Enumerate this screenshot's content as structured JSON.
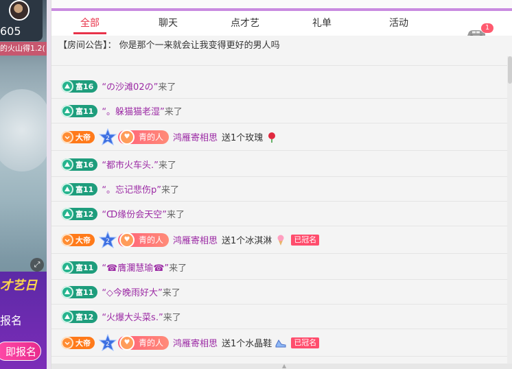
{
  "left": {
    "viewer_count": "605",
    "ticker_text": "的火山得1.2(",
    "promo_title": "才艺日",
    "promo_sign_text": "报名",
    "promo_button": "即报名"
  },
  "tabs": [
    {
      "label": "全部",
      "active": true
    },
    {
      "label": "聊天",
      "active": false
    },
    {
      "label": "点才艺",
      "active": false
    },
    {
      "label": "礼单",
      "active": false
    },
    {
      "label": "活动",
      "active": false
    }
  ],
  "car_badge": "1",
  "notice": {
    "prefix": "【房间公告】：",
    "text": "你是那个一来就会让我变得更好的男人吗"
  },
  "messages": [
    {
      "type": "enter",
      "level": "富16",
      "user": "“の沙滩02の”",
      "action": "来了"
    },
    {
      "type": "enter",
      "level": "富11",
      "user": "“。躲猫猫老湿”",
      "action": "来了"
    },
    {
      "type": "gift",
      "level": "大帝",
      "star_num": "2",
      "tag": "青的人",
      "sender": "鸿雁寄相思",
      "text": "送1个玫瑰",
      "crowned": ""
    },
    {
      "type": "enter",
      "level": "富16",
      "user": "“都市火车头.”",
      "action": "来了"
    },
    {
      "type": "enter",
      "level": "富11",
      "user": "“。忘记悲伤p”",
      "action": "来了"
    },
    {
      "type": "enter",
      "level": "富12",
      "user": "“ↀ缘份会天空”",
      "action": "来了"
    },
    {
      "type": "gift",
      "level": "大帝",
      "star_num": "2",
      "tag": "青的人",
      "sender": "鸿雁寄相思",
      "text": "送1个冰淇淋",
      "crowned": "已冠名"
    },
    {
      "type": "enter",
      "level": "富11",
      "user": "“☎膺瀾慧瑜☎”",
      "action": "来了"
    },
    {
      "type": "enter",
      "level": "富11",
      "user": "“◇今晚雨好大”",
      "action": "来了"
    },
    {
      "type": "enter",
      "level": "富12",
      "user": "“火爆大头菜s.”",
      "action": "来了"
    },
    {
      "type": "gift",
      "level": "大帝",
      "star_num": "2",
      "tag": "青的人",
      "sender": "鸿雁寄相思",
      "text": "送1个水晶鞋",
      "crowned": "已冠名"
    }
  ],
  "colors": {
    "accent": "#e8334a",
    "top_border": "#c98be0",
    "fu_badge": "#1e9d7c",
    "dadi_badge": "#ff7a1a",
    "username": "#9b2aa4"
  }
}
